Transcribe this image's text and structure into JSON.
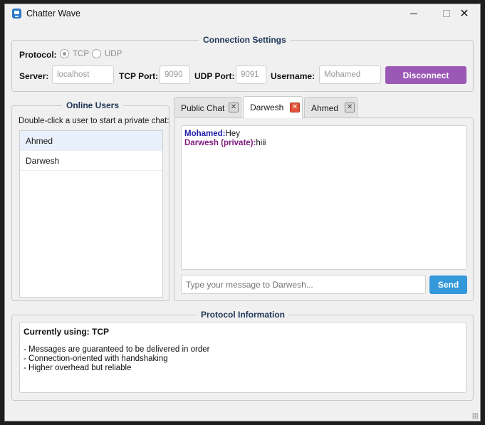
{
  "window": {
    "title": "Chatter Wave",
    "close_glyph": "✕"
  },
  "connection": {
    "title": "Connection Settings",
    "protocol_label": "Protocol:",
    "protocol_options": [
      {
        "label": "TCP",
        "selected": true
      },
      {
        "label": "UDP",
        "selected": false
      }
    ],
    "server_label": "Server:",
    "server_value": "localhost",
    "tcp_port_label": "TCP Port:",
    "tcp_port_value": "9090",
    "udp_port_label": "UDP Port:",
    "udp_port_value": "9091",
    "username_label": "Username:",
    "username_value": "Mohamed",
    "disconnect_label": "Disconnect"
  },
  "online_users": {
    "title": "Online Users",
    "hint": "Double-click a user to start a private chat:",
    "users": [
      {
        "name": "Ahmed",
        "selected": true
      },
      {
        "name": "Darwesh",
        "selected": false
      }
    ]
  },
  "tabs": [
    {
      "label": "Public Chat",
      "active": false,
      "close": "✕"
    },
    {
      "label": "Darwesh",
      "active": true,
      "close": "✕"
    },
    {
      "label": "Ahmed",
      "active": false,
      "close": "✕"
    }
  ],
  "chat": {
    "messages": [
      {
        "sender": "Mohamed:",
        "text": "Hey",
        "color": "#1a1aa6"
      },
      {
        "sender": "Darwesh (private):",
        "text": "hiii",
        "color": "#7d1a7d"
      }
    ],
    "input_placeholder": "Type your message to Darwesh...",
    "send_label": "Send"
  },
  "protocol_info": {
    "title": "Protocol Information",
    "heading": "Currently using: TCP",
    "lines": [
      "- Messages are guaranteed to be delivered in order",
      "- Connection-oriented with handshaking",
      "- Higher overhead but reliable"
    ]
  },
  "colors": {
    "accent_purple": "#9b59b6",
    "accent_blue": "#3498db",
    "close_red": "#e0533a"
  }
}
